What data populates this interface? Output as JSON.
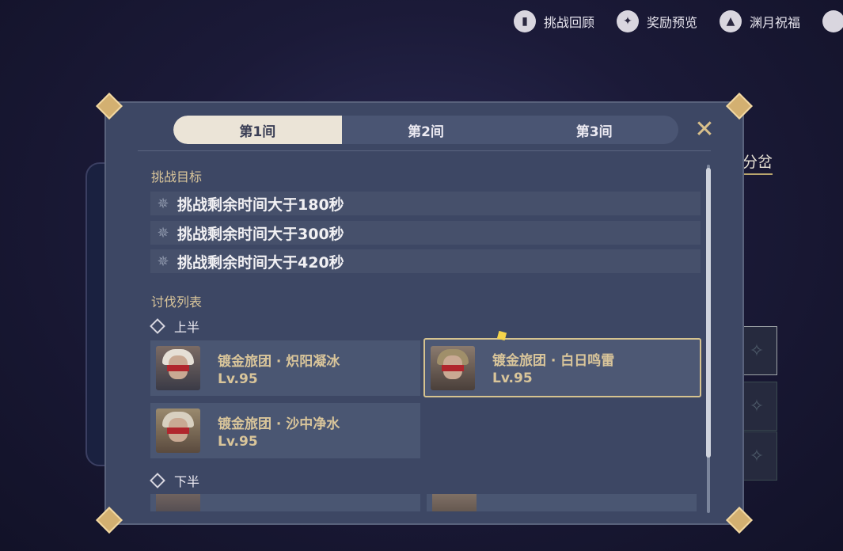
{
  "topbar": {
    "items": [
      {
        "label": "挑战回顾",
        "icon": "book-icon"
      },
      {
        "label": "奖励预览",
        "icon": "star-icon"
      },
      {
        "label": "渊月祝福",
        "icon": "arrow-up-icon"
      }
    ]
  },
  "background": {
    "side_text": "分岔"
  },
  "modal": {
    "tabs": [
      {
        "label": "第1间",
        "active": true
      },
      {
        "label": "第2间",
        "active": false
      },
      {
        "label": "第3间",
        "active": false
      }
    ],
    "goals_title": "挑战目标",
    "goals": [
      "挑战剩余时间大于180秒",
      "挑战剩余时间大于300秒",
      "挑战剩余时间大于420秒"
    ],
    "enemy_list_title": "讨伐列表",
    "first_half_label": "上半",
    "second_half_label": "下半",
    "first_half_enemies": [
      {
        "name": "镀金旅团 · 炽阳凝冰",
        "level": "Lv.95",
        "selected": false
      },
      {
        "name": "镀金旅团 · 白日鸣雷",
        "level": "Lv.95",
        "selected": true
      },
      {
        "name": "镀金旅团 · 沙中净水",
        "level": "Lv.95",
        "selected": false
      }
    ],
    "second_half_enemies": [
      {
        "name": "",
        "level": ""
      },
      {
        "name": "",
        "level": ""
      }
    ]
  },
  "colors": {
    "accent_gold": "#d9c59a",
    "panel": "#3d4764",
    "tab_active": "#ebe4d7"
  }
}
